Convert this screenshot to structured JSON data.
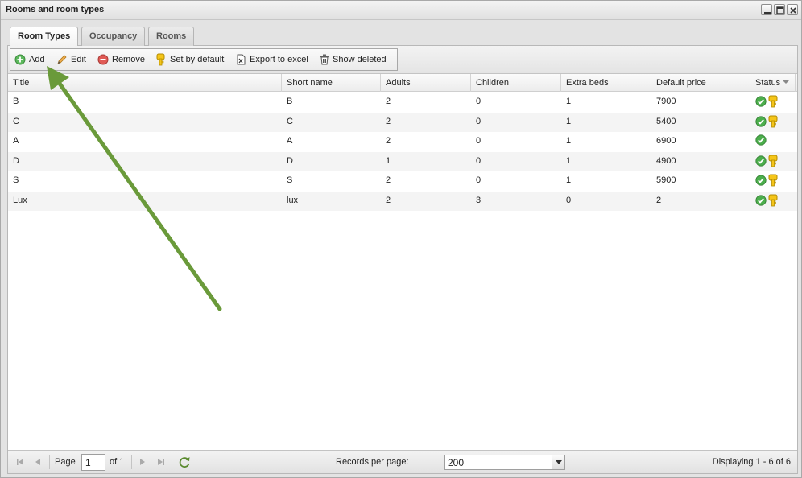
{
  "window": {
    "title": "Rooms and room types",
    "controls": [
      "minimize-icon",
      "maximize-icon",
      "close-icon"
    ]
  },
  "tabs": [
    {
      "label": "Room Types",
      "active": true
    },
    {
      "label": "Occupancy",
      "active": false
    },
    {
      "label": "Rooms",
      "active": false
    }
  ],
  "toolbar": {
    "add_label": "Add",
    "edit_label": "Edit",
    "remove_label": "Remove",
    "set_default_label": "Set by default",
    "export_label": "Export to excel",
    "show_deleted_label": "Show deleted"
  },
  "grid": {
    "columns": [
      "Title",
      "Short name",
      "Adults",
      "Children",
      "Extra beds",
      "Default price",
      "Status"
    ],
    "rows": [
      {
        "title": "B",
        "short": "B",
        "adults": "2",
        "children": "0",
        "extra": "1",
        "price": "7900",
        "status": [
          "check-icon",
          "key-icon"
        ]
      },
      {
        "title": "C",
        "short": "C",
        "adults": "2",
        "children": "0",
        "extra": "1",
        "price": "5400",
        "status": [
          "check-icon",
          "key-icon"
        ]
      },
      {
        "title": "A",
        "short": "A",
        "adults": "2",
        "children": "0",
        "extra": "1",
        "price": "6900",
        "status": [
          "check-icon"
        ]
      },
      {
        "title": "D",
        "short": "D",
        "adults": "1",
        "children": "0",
        "extra": "1",
        "price": "4900",
        "status": [
          "check-icon",
          "key-icon"
        ]
      },
      {
        "title": "S",
        "short": "S",
        "adults": "2",
        "children": "0",
        "extra": "1",
        "price": "5900",
        "status": [
          "check-icon",
          "key-icon"
        ]
      },
      {
        "title": "Lux",
        "short": "lux",
        "adults": "2",
        "children": "3",
        "extra": "0",
        "price": "2",
        "status": [
          "check-icon",
          "key-icon"
        ]
      }
    ]
  },
  "pager": {
    "page_label": "Page",
    "page_value": "1",
    "of_label": "of 1",
    "records_label": "Records per page:",
    "records_value": "200",
    "display_label": "Displaying 1 - 6 of 6"
  },
  "colors": {
    "annotation_arrow": "#6a9a3a",
    "check": "#4cae4c",
    "key": "#e6b800",
    "remove": "#d9534f"
  }
}
